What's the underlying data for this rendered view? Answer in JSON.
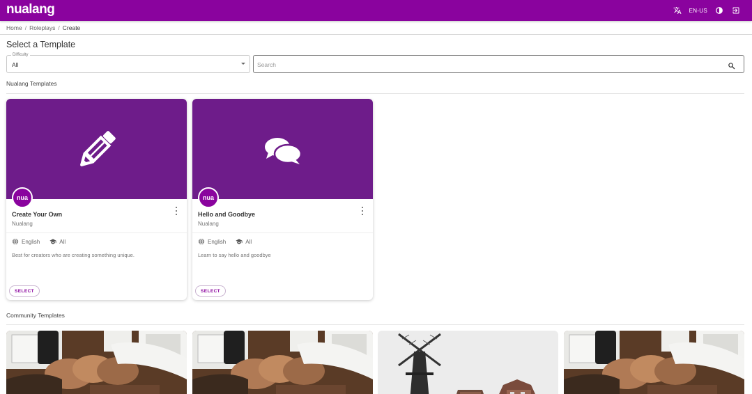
{
  "app": {
    "logo": "nualang",
    "language_code": "EN-US",
    "icons": [
      "translate-icon",
      "brightness-icon",
      "logout-icon"
    ]
  },
  "breadcrumb": {
    "items": [
      "Home",
      "Roleplays",
      "Create"
    ]
  },
  "page_title": "Select a Template",
  "filters": {
    "difficulty_label": "Difficulty",
    "difficulty_value": "All",
    "search_placeholder": "Search",
    "search_value": ""
  },
  "sections": {
    "nualang_templates": "Nualang Templates",
    "community_templates": "Community Templates"
  },
  "nualang_cards": [
    {
      "title": "Create Your Own",
      "author": "Nualang",
      "language": "English",
      "level": "All",
      "description": "Best for creators who are creating something unique.",
      "button": "SELECT",
      "hero_icon": "pencil-icon",
      "avatar_text": "nua"
    },
    {
      "title": "Hello and Goodbye",
      "author": "Nualang",
      "language": "English",
      "level": "All",
      "description": "Learn to say hello and goodbye",
      "button": "SELECT",
      "hero_icon": "chat-bubbles-icon",
      "avatar_text": "nua"
    }
  ],
  "community_cards": [
    {
      "image": "teamwork-fists-image"
    },
    {
      "image": "teamwork-fists-image"
    },
    {
      "image": "windmill-image"
    },
    {
      "image": "teamwork-fists-image"
    }
  ],
  "colors": {
    "brand": "#8a039e",
    "card_hero": "#6e1c8a"
  }
}
